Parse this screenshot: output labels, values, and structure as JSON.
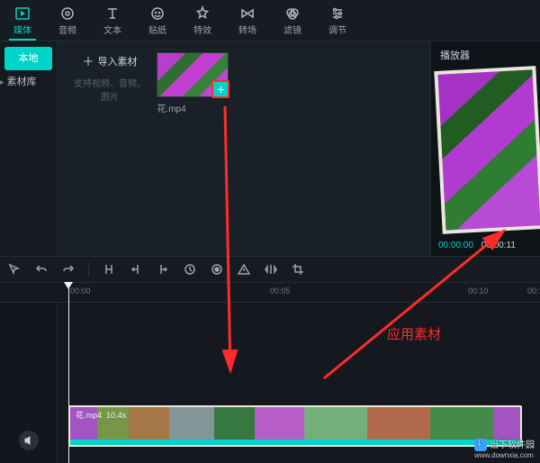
{
  "toolbar": [
    {
      "id": "media",
      "label": "媒体"
    },
    {
      "id": "audio",
      "label": "音频"
    },
    {
      "id": "text",
      "label": "文本"
    },
    {
      "id": "sticker",
      "label": "贴纸"
    },
    {
      "id": "effect",
      "label": "特效"
    },
    {
      "id": "transition",
      "label": "转场"
    },
    {
      "id": "filter",
      "label": "滤镜"
    },
    {
      "id": "adjust",
      "label": "调节"
    }
  ],
  "sidebar": {
    "tab_local": "本地",
    "tab_library": "素材库"
  },
  "import": {
    "button": "导入素材",
    "hint": "支持视频、音频、图片"
  },
  "clip": {
    "name": "花.mp4"
  },
  "preview": {
    "title": "播放器",
    "current": "00:00:00",
    "duration": "00:00:11"
  },
  "ruler": {
    "t0": "00:00",
    "t1": "00:05",
    "t2": "00:10",
    "t3": "00:1"
  },
  "track": {
    "clip_name": "花.mp4",
    "clip_duration": "10.4s"
  },
  "annotation": {
    "apply": "应用素材"
  },
  "watermark": {
    "name": "当下软件园",
    "url": "www.downxia.com"
  }
}
